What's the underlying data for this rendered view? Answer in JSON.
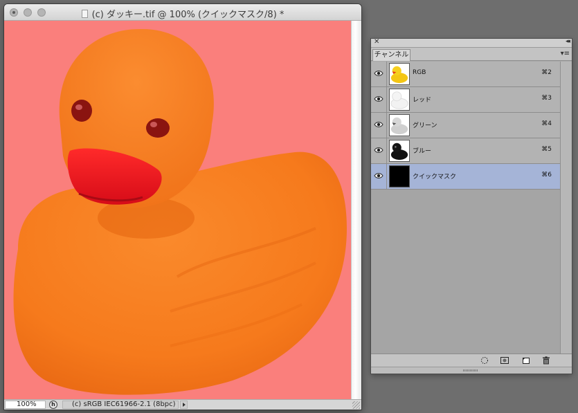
{
  "document": {
    "title": "(c) ダッキー.tif @ 100% (クイックマスク/8) *",
    "zoom": "100%",
    "color_profile": "(c) sRGB IEC61966-2.1 (8bpc)",
    "status_icon_glyph": "h",
    "canvas_mask_color": "#fa7f7c",
    "duck_color": "#f87a1d",
    "beak_color": "#e5141e"
  },
  "panel": {
    "close_glyph": "✕",
    "collapse_glyph": "◂◂",
    "tab_label": "チャンネル",
    "menu_glyph": "▾≡",
    "channels": [
      {
        "label": "RGB",
        "shortcut": "⌘2",
        "thumb": "rgb-thumb",
        "selected": false
      },
      {
        "label": "レッド",
        "shortcut": "⌘3",
        "thumb": "red-thumb",
        "selected": false
      },
      {
        "label": "グリーン",
        "shortcut": "⌘4",
        "thumb": "green-thumb",
        "selected": false
      },
      {
        "label": "ブルー",
        "shortcut": "⌘5",
        "thumb": "blue-thumb",
        "selected": false
      },
      {
        "label": "クイックマスク",
        "shortcut": "⌘6",
        "thumb": "quickmask-thumb",
        "selected": true
      }
    ],
    "footer_icons": [
      "load-selection-icon",
      "save-selection-icon",
      "new-channel-icon",
      "trash-icon"
    ]
  }
}
